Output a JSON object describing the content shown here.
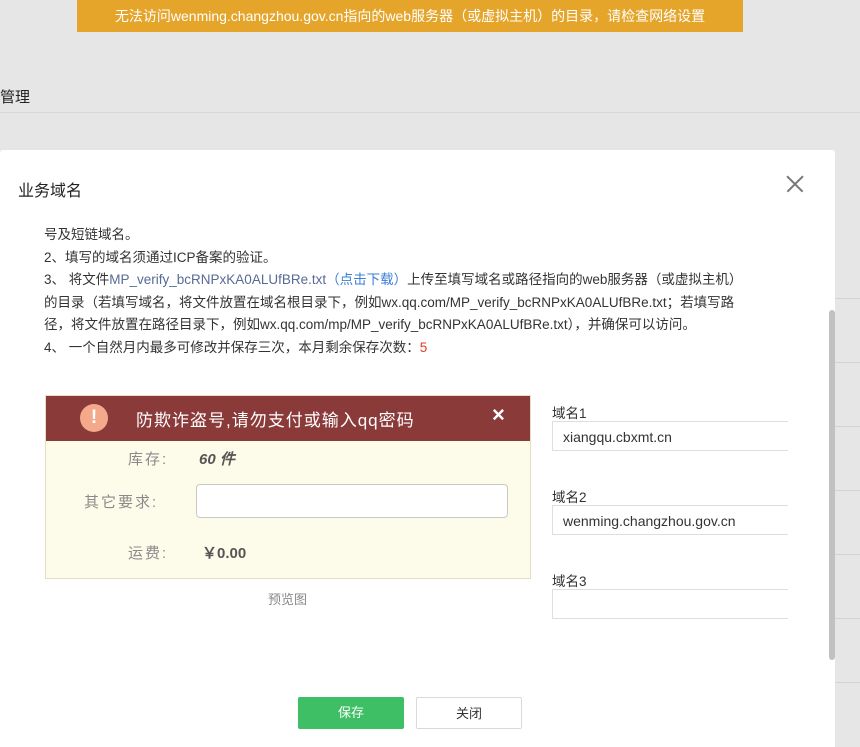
{
  "warning_banner": "无法访问wenming.changzhou.gov.cn指向的web服务器（或虚拟主机）的目录，请检查网络设置",
  "background": {
    "page_title": "管理"
  },
  "dialog": {
    "title": "业务域名",
    "notes": {
      "line1": "号及短链域名。",
      "line2": "2、填写的域名须通过ICP备案的验证。",
      "line3_prefix": "3、 将文件",
      "file_name": "MP_verify_bcRNPxKA0ALUfBRe.txt",
      "download_text": "（点击下载）",
      "line3_suffix": "上传至填写域名或路径指向的web服务器（或虚拟主机）",
      "line4": "的目录（若填写域名，将文件放置在域名根目录下，例如wx.qq.com/MP_verify_bcRNPxKA0ALUfBRe.txt；若填写路",
      "line5": "径，将文件放置在路径目录下，例如wx.qq.com/mp/MP_verify_bcRNPxKA0ALUfBRe.txt），并确保可以访问。",
      "line6_prefix": "4、 一个自然月内最多可修改并保存三次，本月剩余保存次数：",
      "remaining_count": "5"
    },
    "preview": {
      "warning_text": "防欺诈盗号,请勿支付或输入qq密码",
      "close_glyph": "×",
      "alert_glyph": "!",
      "stock_label": "库存:",
      "stock_value": "60 件",
      "other_label": "其它要求:",
      "shipping_label": "运费:",
      "shipping_value": "￥0.00",
      "caption": "预览图"
    },
    "domains": [
      {
        "label": "域名1",
        "value": "xiangqu.cbxmt.cn"
      },
      {
        "label": "域名2",
        "value": "wenming.changzhou.gov.cn"
      },
      {
        "label": "域名3",
        "value": ""
      }
    ],
    "buttons": {
      "save": "保存",
      "close": "关闭"
    }
  }
}
